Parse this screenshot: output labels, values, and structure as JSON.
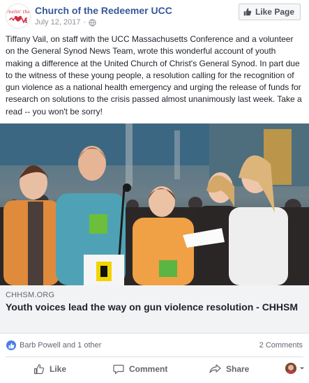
{
  "header": {
    "page_name": "Church of the Redeemer UCC",
    "date": "July 12, 2017",
    "separator": "·",
    "like_page_label": "Like Page",
    "logo_text": "Feelin' the"
  },
  "post": {
    "text": "Tiffany Vail, on staff with the UCC Massachusetts Conference and a volunteer on the General Synod News Team, wrote this wonderful account of youth making a difference at the United Church of Christ's General Synod. In part due to the witness of these young people, a resolution calling for the recognition of gun violence as a national health emergency and urging the release of funds for research on solutions to the crisis passed almost unanimously last week. Take a read -- you won't be sorry!"
  },
  "link": {
    "domain": "CHHSM.ORG",
    "title": "Youth voices lead the way on gun violence resolution - CHHSM"
  },
  "reactions": {
    "names": "Barb Powell and 1 other",
    "comments": "2 Comments"
  },
  "actions": {
    "like": "Like",
    "comment": "Comment",
    "share": "Share"
  },
  "colors": {
    "link_blue": "#365899",
    "like_blue": "#4a7de4",
    "muted": "#606770"
  }
}
